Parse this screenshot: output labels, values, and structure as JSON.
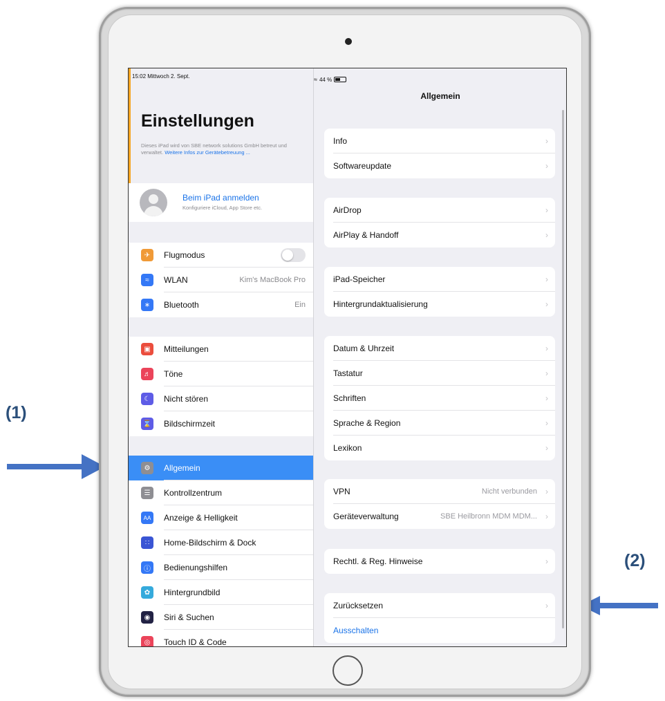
{
  "status": {
    "time": "15:02 Mittwoch 2. Sept.",
    "battery": "44 %"
  },
  "left": {
    "title": "Einstellungen",
    "mdm_text": "Dieses iPad wird von SBE network solutions GmbH betreut und verwaltet.",
    "mdm_link": "Weitere Infos zur Gerätebetreuung ...",
    "profile": {
      "title": "Beim iPad anmelden",
      "subtitle": "Konfiguriere iCloud, App Store etc."
    },
    "group1": [
      {
        "label": "Flugmodus",
        "icon": "airplane-icon",
        "color": "#f09a37"
      },
      {
        "label": "WLAN",
        "value": "Kim's MacBook Pro",
        "icon": "wifi-icon",
        "color": "#3478f6"
      },
      {
        "label": "Bluetooth",
        "value": "Ein",
        "icon": "bluetooth-icon",
        "color": "#3478f6"
      }
    ],
    "group2": [
      {
        "label": "Mitteilungen",
        "icon": "notifications-icon",
        "color": "#eb4d3d"
      },
      {
        "label": "Töne",
        "icon": "sound-icon",
        "color": "#eb445a"
      },
      {
        "label": "Nicht stören",
        "icon": "moon-icon",
        "color": "#5e5ce6"
      },
      {
        "label": "Bildschirmzeit",
        "icon": "hourglass-icon",
        "color": "#5e5ce6"
      }
    ],
    "group3": [
      {
        "label": "Allgemein",
        "icon": "gear-icon",
        "color": "#8e8e93",
        "selected": true
      },
      {
        "label": "Kontrollzentrum",
        "icon": "control-center-icon",
        "color": "#8e8e93"
      },
      {
        "label": "Anzeige & Helligkeit",
        "icon": "display-icon",
        "color": "#3478f6"
      },
      {
        "label": "Home-Bildschirm & Dock",
        "icon": "home-screen-icon",
        "color": "#3a55d4"
      },
      {
        "label": "Bedienungshilfen",
        "icon": "accessibility-icon",
        "color": "#3478f6"
      },
      {
        "label": "Hintergrundbild",
        "icon": "wallpaper-icon",
        "color": "#35aadc"
      },
      {
        "label": "Siri & Suchen",
        "icon": "siri-icon",
        "color": "#222244"
      },
      {
        "label": "Touch ID & Code",
        "icon": "fingerprint-icon",
        "color": "#eb445a"
      }
    ]
  },
  "right": {
    "title": "Allgemein",
    "g1": [
      {
        "label": "Info"
      },
      {
        "label": "Softwareupdate"
      }
    ],
    "g2": [
      {
        "label": "AirDrop"
      },
      {
        "label": "AirPlay & Handoff"
      }
    ],
    "g3": [
      {
        "label": "iPad-Speicher"
      },
      {
        "label": "Hintergrundaktualisierung"
      }
    ],
    "g4": [
      {
        "label": "Datum & Uhrzeit"
      },
      {
        "label": "Tastatur"
      },
      {
        "label": "Schriften"
      },
      {
        "label": "Sprache & Region"
      },
      {
        "label": "Lexikon"
      }
    ],
    "g5": [
      {
        "label": "VPN",
        "value": "Nicht verbunden"
      },
      {
        "label": "Geräteverwaltung",
        "value": "SBE Heilbronn MDM MDM..."
      }
    ],
    "g6": [
      {
        "label": "Rechtl. & Reg. Hinweise"
      }
    ],
    "g7": [
      {
        "label": "Zurücksetzen"
      },
      {
        "label": "Ausschalten"
      }
    ]
  },
  "annotations": {
    "label1": "(1)",
    "label2": "(2)"
  },
  "colors": {
    "accent_blue": "#3a8ef6",
    "arrow": "#4472c4"
  }
}
